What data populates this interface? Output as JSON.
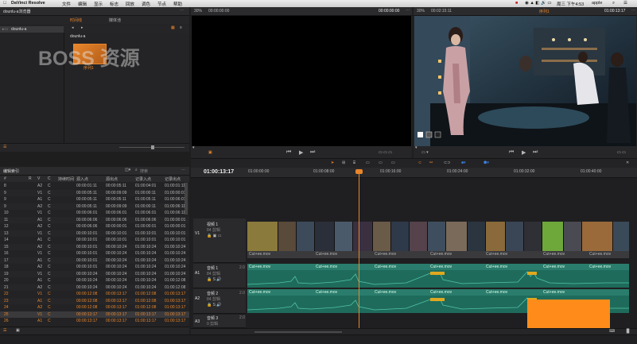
{
  "menubar": {
    "app": "DaVinci Resolve",
    "items": [
      "文件",
      "编辑",
      "显示",
      "标志",
      "回放",
      "调色",
      "节点",
      "帮助"
    ],
    "clock": "周三 下午4:53",
    "user": "apple"
  },
  "media_pool": {
    "project": "dounlu-a浏览器",
    "tabs": [
      "时间线",
      "媒体池"
    ],
    "folder": "dounlu-a",
    "bin_title": "dounlu-a",
    "clip_label": "序列1"
  },
  "source_viewer": {
    "zoom": "30%",
    "timecode_left": "00:00:00:00",
    "timecode_right": "00:00:00:00"
  },
  "program_viewer": {
    "zoom": "30%",
    "timecode_left": "00:02:15:11",
    "title": "序列1",
    "timecode_right": "01:00:13:17"
  },
  "edit_index": {
    "title": "编辑索引",
    "search_placeholder": "搜索",
    "columns": [
      "#",
      "R",
      "V",
      "C",
      "持续时间",
      "源入点",
      "源出点",
      "记录入点",
      "记录出点"
    ],
    "rows": [
      [
        "8",
        "",
        "A2",
        "C",
        "",
        "00:00:01:11",
        "00:00:05:11",
        "01:00:04:01",
        "01:00:01:11"
      ],
      [
        "9",
        "",
        "V1",
        "C",
        "",
        "00:00:05:11",
        "00:00:09:09",
        "01:00:00:11",
        "01:00:00:01"
      ],
      [
        "9",
        "",
        "A1",
        "C",
        "",
        "00:00:05:11",
        "00:00:05:11",
        "01:00:05:11",
        "01:00:06:01"
      ],
      [
        "9",
        "",
        "A2",
        "C",
        "",
        "00:00:05:11",
        "00:00:09:09",
        "01:00:00:11",
        "01:00:06:11"
      ],
      [
        "10",
        "",
        "V1",
        "C",
        "",
        "00:00:06:01",
        "00:00:06:01",
        "01:00:06:01",
        "01:00:06:11"
      ],
      [
        "11",
        "",
        "A1",
        "C",
        "",
        "00:00:06:06",
        "00:00:06:06",
        "01:00:06:06",
        "01:00:00:01"
      ],
      [
        "12",
        "",
        "A2",
        "C",
        "",
        "00:00:06:06",
        "00:00:00:01",
        "01:00:00:01",
        "01:00:00:01"
      ],
      [
        "13",
        "",
        "V1",
        "C",
        "",
        "00:00:10:01",
        "00:00:10:01",
        "01:00:10:01",
        "01:00:10:01"
      ],
      [
        "14",
        "",
        "A1",
        "C",
        "",
        "00:00:10:01",
        "00:00:10:01",
        "01:00:10:01",
        "01:00:10:01"
      ],
      [
        "15",
        "",
        "A2",
        "C",
        "",
        "00:00:10:01",
        "00:00:10:24",
        "01:00:10:24",
        "01:00:10:24"
      ],
      [
        "16",
        "",
        "V1",
        "C",
        "",
        "00:00:10:01",
        "00:00:10:24",
        "01:00:10:24",
        "01:00:10:24"
      ],
      [
        "17",
        "",
        "A1",
        "C",
        "",
        "00:00:10:01",
        "00:00:10:24",
        "01:00:10:24",
        "01:00:10:24"
      ],
      [
        "18",
        "",
        "A2",
        "C",
        "",
        "00:00:10:01",
        "00:00:10:24",
        "01:00:10:24",
        "01:00:10:24"
      ],
      [
        "19",
        "",
        "V1",
        "C",
        "",
        "00:00:10:24",
        "00:00:10:24",
        "01:00:10:24",
        "01:00:10:24"
      ],
      [
        "20",
        "",
        "A1",
        "C",
        "",
        "00:00:10:24",
        "00:00:10:24",
        "01:00:10:24",
        "01:00:12:08"
      ],
      [
        "21",
        "",
        "A2",
        "C",
        "",
        "00:00:10:24",
        "00:00:10:24",
        "01:00:10:24",
        "01:00:12:08"
      ],
      [
        "22",
        "",
        "V1",
        "C",
        "",
        "00:00:12:08",
        "00:00:13:17",
        "01:00:12:08",
        "01:00:13:17"
      ],
      [
        "23",
        "",
        "A1",
        "C",
        "",
        "00:00:12:08",
        "00:00:13:17",
        "01:00:12:08",
        "01:00:13:17"
      ],
      [
        "24",
        "",
        "A2",
        "C",
        "",
        "00:00:12:08",
        "00:00:13:17",
        "01:00:12:08",
        "01:00:13:17"
      ],
      [
        "25",
        "",
        "V1",
        "C",
        "",
        "00:00:13:17",
        "00:00:13:17",
        "01:00:13:17",
        "01:00:13:17"
      ],
      [
        "26",
        "",
        "A1",
        "C",
        "",
        "00:00:13:17",
        "00:00:13:17",
        "01:00:13:17",
        "01:00:13:17"
      ]
    ],
    "highlight_from": 16,
    "selected_row": 19
  },
  "timeline": {
    "current_timecode": "01:00:13:17",
    "ruler_ticks": [
      "01:00:00:00",
      "01:00:08:00",
      "01:00:16:00",
      "01:00:24:00",
      "01:00:32:00",
      "01:00:40:00"
    ],
    "tracks": [
      {
        "id": "V1",
        "name": "视频 1",
        "sub": "84 剪辑"
      },
      {
        "id": "A1",
        "name": "音频 1",
        "sub": "84 剪辑",
        "badge": "2.0"
      },
      {
        "id": "A2",
        "name": "音频 2",
        "sub": "84 剪辑",
        "badge": "2.0"
      },
      {
        "id": "A3",
        "name": "音频 3",
        "sub": "0 剪辑",
        "badge": "2.0"
      }
    ],
    "clip_name": "Cut+ee.mov"
  },
  "colors": {
    "accent": "#e8862c",
    "audio": "#1f6b5b"
  }
}
